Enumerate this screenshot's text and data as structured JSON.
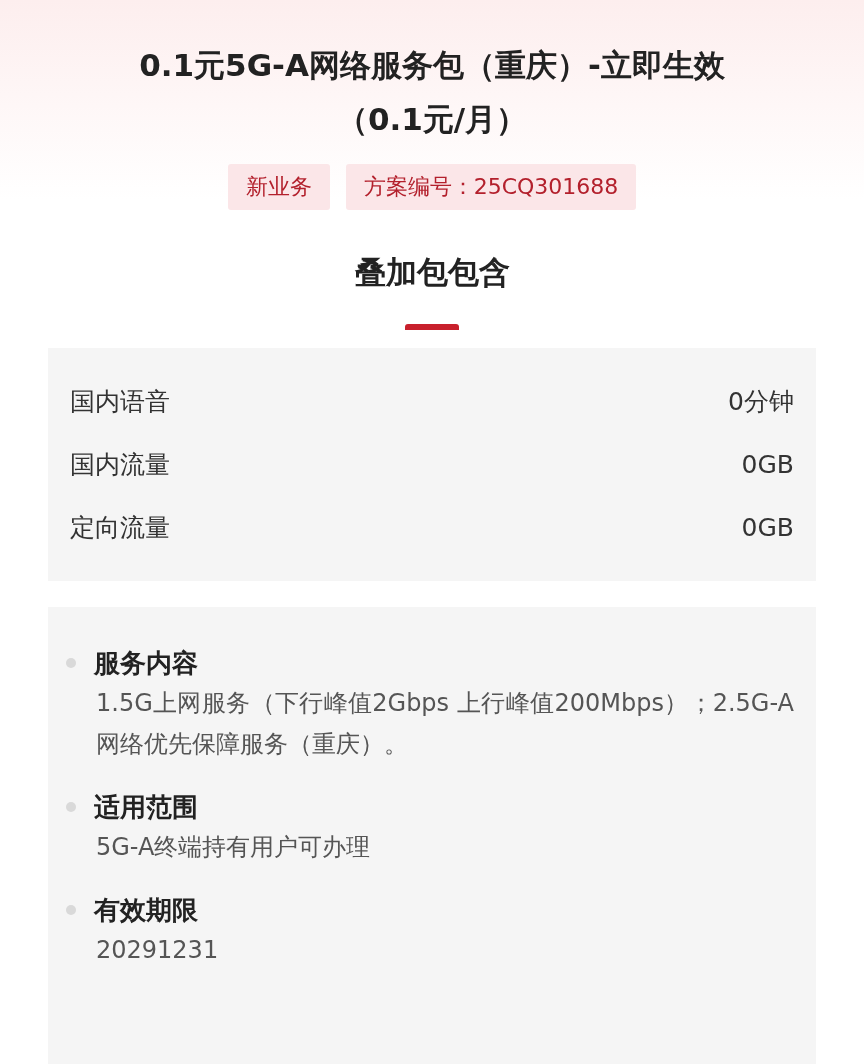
{
  "title": "0.1元5G-A网络服务包（重庆）-立即生效（0.1元/月）",
  "tags": [
    "新业务",
    "方案编号：25CQ301688"
  ],
  "section_title": "叠加包包含",
  "allowances": [
    {
      "label": "国内语音",
      "value": "0分钟"
    },
    {
      "label": "国内流量",
      "value": "0GB"
    },
    {
      "label": "定向流量",
      "value": "0GB"
    }
  ],
  "details": [
    {
      "heading": "服务内容",
      "text": "1.5G上网服务（下行峰值2Gbps 上行峰值200Mbps）；2.5G-A网络优先保障服务（重庆）。"
    },
    {
      "heading": "适用范围",
      "text": "5G-A终端持有用户可办理"
    },
    {
      "heading": "有效期限",
      "text": "20291231"
    }
  ]
}
